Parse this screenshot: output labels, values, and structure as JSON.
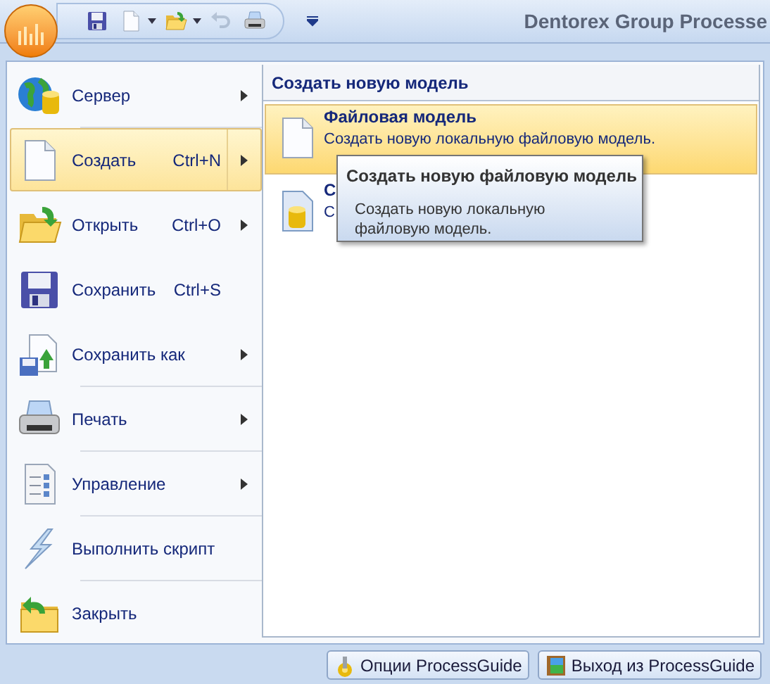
{
  "app_title": "Dentorex Group Processe",
  "toolbar": [
    {
      "kind": "save",
      "disabled": false,
      "dropdown": false
    },
    {
      "kind": "new",
      "disabled": false,
      "dropdown": true
    },
    {
      "kind": "open",
      "disabled": false,
      "dropdown": true
    },
    {
      "kind": "undo",
      "disabled": true,
      "dropdown": false
    },
    {
      "kind": "print",
      "disabled": false,
      "dropdown": false
    }
  ],
  "menu": [
    {
      "kind": "server",
      "label": "Сервер",
      "submenu": true,
      "selected": false,
      "divider_after": true
    },
    {
      "kind": "new",
      "label": "Создать",
      "shortcut": "Ctrl+N",
      "submenu": true,
      "selected": true,
      "divider_after": false
    },
    {
      "kind": "open",
      "label": "Открыть",
      "shortcut": "Ctrl+O",
      "submenu": true,
      "selected": false,
      "divider_after": false
    },
    {
      "kind": "save",
      "label": "Сохранить",
      "shortcut": "Ctrl+S",
      "submenu": false,
      "selected": false,
      "divider_after": false
    },
    {
      "kind": "saveas",
      "label": "Сохранить как",
      "submenu": true,
      "selected": false,
      "divider_after": true
    },
    {
      "kind": "print",
      "label": "Печать",
      "submenu": true,
      "selected": false,
      "divider_after": true
    },
    {
      "kind": "manage",
      "label": "Управление",
      "submenu": true,
      "selected": false,
      "divider_after": true
    },
    {
      "kind": "script",
      "label": "Выполнить скрипт",
      "submenu": false,
      "selected": false,
      "divider_after": true
    },
    {
      "kind": "close",
      "label": "Закрыть",
      "submenu": false,
      "selected": false,
      "divider_after": false
    }
  ],
  "submenu": {
    "title": "Создать новую модель",
    "items": [
      {
        "kind": "file",
        "title": "Файловая модель",
        "description": "Создать новую локальную файловую модель.",
        "selected": true
      },
      {
        "kind": "database",
        "title": "С",
        "description": "С",
        "selected": false
      }
    ]
  },
  "tooltip": {
    "title": "Создать новую файловую модель",
    "text": "Создать новую локальную файловую модель."
  },
  "buttons": [
    {
      "kind": "options",
      "label": "Опции ProcessGuide"
    },
    {
      "kind": "exit",
      "label": "Выход из ProcessGuide"
    }
  ]
}
